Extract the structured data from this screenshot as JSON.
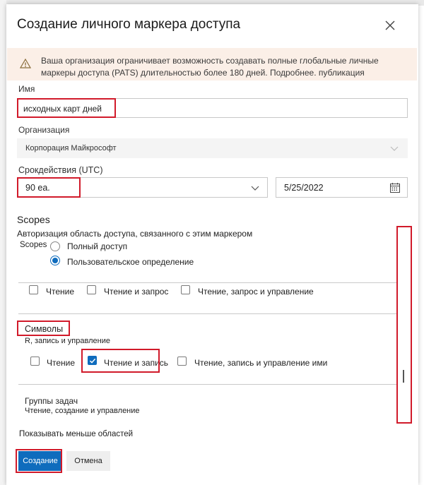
{
  "dialog": {
    "title": "Создание личного маркера доступа",
    "warning": "Ваша организация ограничивает возможность создавать полные глобальные личные маркеры доступа (PATS) длительностью более 180 дней. Подробнее. публикация"
  },
  "form": {
    "name_label": "Имя",
    "name_value": "исходных карт дней",
    "org_label": "Организация",
    "org_value": "Корпорация Майкрософт",
    "expiry_label": "Срокдействия (UTC)",
    "expiry_value": "90 еа.",
    "expiry_date": "5/25/2022"
  },
  "scopes": {
    "title": "Scopes",
    "description": "Авторизация область доступа, связанного с этим маркером",
    "scopes_label": "Scopes",
    "full_access": "Полный доступ",
    "custom": "Пользовательское определение",
    "row1": {
      "read": "Чтение",
      "read_query": "Чтение и запрос",
      "read_query_manage": "Чтение, запрос и управление"
    },
    "symbols": {
      "title": "Символы",
      "subtitle": "R, запись и управление",
      "read": "Чтение",
      "read_write": "Чтение и запись",
      "read_write_manage": "Чтение, запись и управление ими"
    },
    "task_groups": {
      "title": "Группы задач",
      "subtitle": "Чтение, создание и управление"
    },
    "show_less": "Показывать меньше областей"
  },
  "buttons": {
    "create": "Создание",
    "cancel": "Отмена"
  },
  "colors": {
    "accent": "#0f6cbd",
    "highlight": "#d11a2a",
    "warning_bg": "#fbefe7"
  }
}
